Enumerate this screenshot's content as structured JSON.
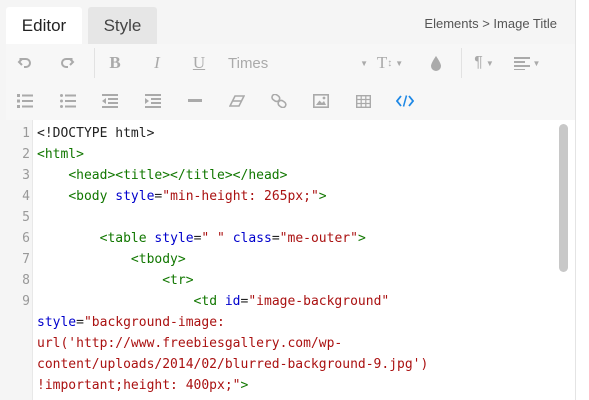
{
  "tabs": [
    {
      "label": "Editor",
      "active": true
    },
    {
      "label": "Style",
      "active": false
    }
  ],
  "breadcrumb": "Elements > Image Title",
  "toolbar": {
    "row1": [
      {
        "name": "undo-icon"
      },
      {
        "name": "redo-icon"
      },
      {
        "name": "bold-icon",
        "glyph": "B"
      },
      {
        "name": "italic-icon",
        "glyph": "I"
      },
      {
        "name": "underline-icon",
        "glyph": "U"
      },
      {
        "name": "font-family-select",
        "value": "Times"
      },
      {
        "name": "font-size-icon",
        "glyph": "T"
      },
      {
        "name": "text-color-icon"
      },
      {
        "name": "paragraph-format-icon",
        "glyph": "¶"
      },
      {
        "name": "align-icon"
      }
    ],
    "row2": [
      {
        "name": "ordered-list-icon"
      },
      {
        "name": "unordered-list-icon"
      },
      {
        "name": "outdent-icon"
      },
      {
        "name": "indent-icon"
      },
      {
        "name": "horizontal-line-icon"
      },
      {
        "name": "eraser-icon"
      },
      {
        "name": "link-icon"
      },
      {
        "name": "image-icon"
      },
      {
        "name": "table-icon"
      },
      {
        "name": "code-view-icon",
        "active": true
      }
    ]
  },
  "code": {
    "line_numbers": [
      "1",
      "2",
      "3",
      "4",
      "5",
      "6",
      "7",
      "8",
      "9"
    ],
    "lines": [
      [
        {
          "t": "text",
          "v": "<!DOCTYPE html>"
        }
      ],
      [
        {
          "t": "tag",
          "v": "<html>"
        }
      ],
      [
        {
          "t": "text",
          "v": "    "
        },
        {
          "t": "tag",
          "v": "<head><title></title></head>"
        }
      ],
      [
        {
          "t": "text",
          "v": "    "
        },
        {
          "t": "tag",
          "v": "<body "
        },
        {
          "t": "attr",
          "v": "style"
        },
        {
          "t": "text",
          "v": "="
        },
        {
          "t": "str",
          "v": "\"min-height: 265px;\""
        },
        {
          "t": "tag",
          "v": ">"
        }
      ],
      [],
      [
        {
          "t": "text",
          "v": "        "
        },
        {
          "t": "tag",
          "v": "<table "
        },
        {
          "t": "attr",
          "v": "style"
        },
        {
          "t": "text",
          "v": "="
        },
        {
          "t": "str",
          "v": "\" \""
        },
        {
          "t": "text",
          "v": " "
        },
        {
          "t": "attr",
          "v": "class"
        },
        {
          "t": "text",
          "v": "="
        },
        {
          "t": "str",
          "v": "\"me-outer\""
        },
        {
          "t": "tag",
          "v": ">"
        }
      ],
      [
        {
          "t": "text",
          "v": "            "
        },
        {
          "t": "tag",
          "v": "<tbody>"
        }
      ],
      [
        {
          "t": "text",
          "v": "                "
        },
        {
          "t": "tag",
          "v": "<tr>"
        }
      ],
      [
        {
          "t": "text",
          "v": "                    "
        },
        {
          "t": "tag",
          "v": "<td "
        },
        {
          "t": "attr",
          "v": "id"
        },
        {
          "t": "text",
          "v": "="
        },
        {
          "t": "str",
          "v": "\"image-background\""
        }
      ],
      [
        {
          "t": "attr",
          "v": "style"
        },
        {
          "t": "text",
          "v": "="
        },
        {
          "t": "str",
          "v": "\"background-image:"
        }
      ],
      [
        {
          "t": "str",
          "v": "url('http://www.freebiesgallery.com/wp-"
        }
      ],
      [
        {
          "t": "str",
          "v": "content/uploads/2014/02/blurred-background-9.jpg')"
        }
      ],
      [
        {
          "t": "str",
          "v": "!important;height: 400px;\""
        },
        {
          "t": "tag",
          "v": ">"
        }
      ]
    ],
    "scroll_fraction_visible": 0.55
  }
}
